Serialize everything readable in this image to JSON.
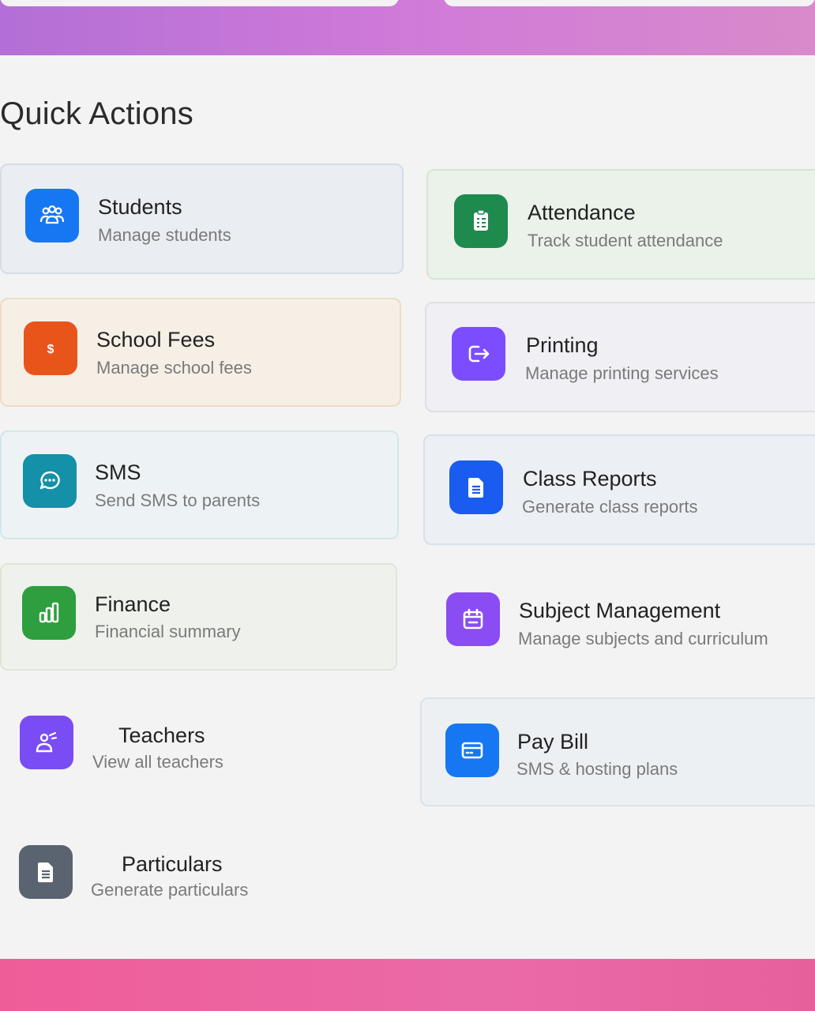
{
  "section": {
    "title": "Quick Actions"
  },
  "actions": [
    {
      "label": "Students",
      "subtitle": "Manage students",
      "icon": "users-icon",
      "color": "#1677f2"
    },
    {
      "label": "Attendance",
      "subtitle": "Track student attendance",
      "icon": "clipboard-icon",
      "color": "#1e8a4e"
    },
    {
      "label": "School Fees",
      "subtitle": "Manage school fees",
      "icon": "dollar-icon",
      "color": "#e8541a"
    },
    {
      "label": "Printing",
      "subtitle": "Manage printing services",
      "icon": "printer-export-icon",
      "color": "#7c4dff"
    },
    {
      "label": "SMS",
      "subtitle": "Send SMS to parents",
      "icon": "chat-bubble-icon",
      "color": "#1490a8"
    },
    {
      "label": "Class Reports",
      "subtitle": "Generate class reports",
      "icon": "document-icon",
      "color": "#1a5cf0"
    },
    {
      "label": "Finance",
      "subtitle": "Financial summary",
      "icon": "bar-chart-icon",
      "color": "#2f9e3e"
    },
    {
      "label": "Subject Management",
      "subtitle": "Manage subjects and curriculum",
      "icon": "calendar-icon",
      "color": "#8a4cf3"
    },
    {
      "label": "Teachers",
      "subtitle": "View all teachers",
      "icon": "teacher-icon",
      "color": "#7a4cf3"
    },
    {
      "label": "Pay Bill",
      "subtitle": "SMS & hosting plans",
      "icon": "credit-card-icon",
      "color": "#1677f2"
    },
    {
      "label": "Particulars",
      "subtitle": "Generate particulars",
      "icon": "document-icon",
      "color": "#5a6470"
    }
  ]
}
